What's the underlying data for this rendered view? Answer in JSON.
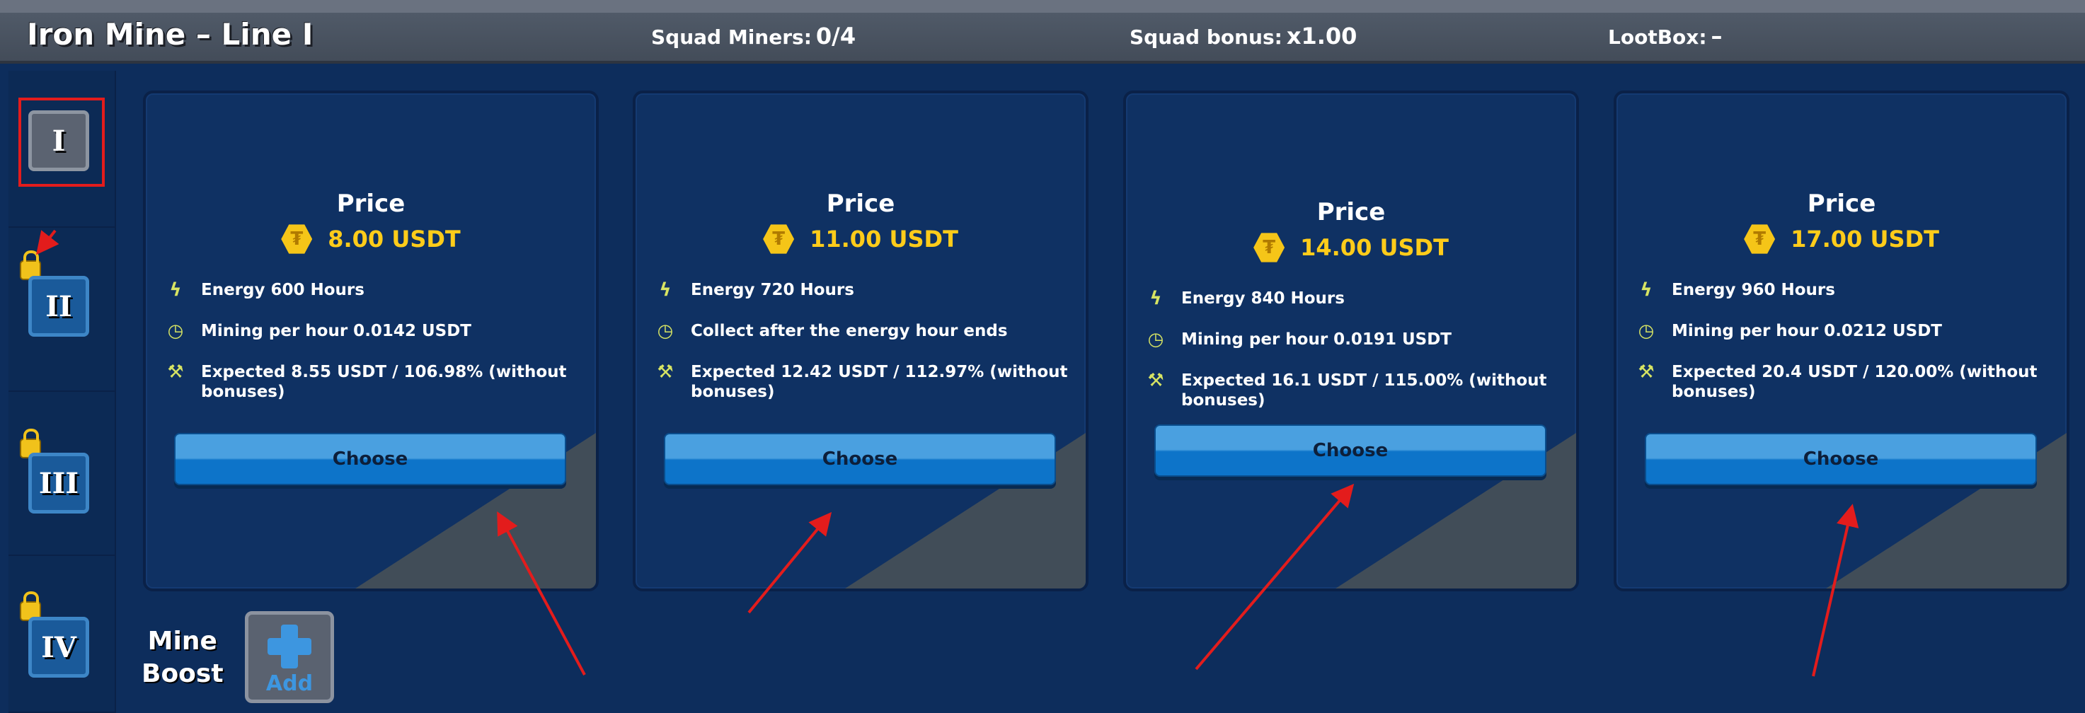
{
  "header": {
    "title": "Iron Mine – Line I",
    "squad_miners_label": "Squad Miners:",
    "squad_miners_value": "0/4",
    "squad_bonus_label": "Squad bonus:",
    "squad_bonus_value": "x1.00",
    "lootbox_label": "LootBox:",
    "lootbox_value": "–"
  },
  "sidebar": {
    "tiers": [
      {
        "label": "I",
        "locked": false,
        "selected": true
      },
      {
        "label": "II",
        "locked": true
      },
      {
        "label": "III",
        "locked": true
      },
      {
        "label": "IV",
        "locked": true
      }
    ]
  },
  "cards": [
    {
      "price_label": "Price",
      "price": "8.00 USDT",
      "features": [
        "Energy 600 Hours",
        "Mining per hour 0.0142 USDT",
        "Expected 8.55 USDT / 106.98% (without bonuses)"
      ],
      "button": "Choose"
    },
    {
      "price_label": "Price",
      "price": "11.00 USDT",
      "features": [
        "Energy 720 Hours",
        "Collect after the energy hour ends",
        "Expected 12.42 USDT / 112.97% (without bonuses)"
      ],
      "button": "Choose"
    },
    {
      "price_label": "Price",
      "price": "14.00 USDT",
      "features": [
        "Energy 840 Hours",
        "Mining per hour 0.0191 USDT",
        "Expected 16.1 USDT / 115.00% (without bonuses)"
      ],
      "button": "Choose"
    },
    {
      "price_label": "Price",
      "price": "17.00 USDT",
      "features": [
        "Energy 960 Hours",
        "Mining per hour 0.0212 USDT",
        "Expected 20.4 USDT / 120.00% (without bonuses)"
      ],
      "button": "Choose"
    }
  ],
  "icons": [
    "lightning-icon",
    "clock-icon",
    "shovel-icon",
    "usdt-coin-icon",
    "lock-icon",
    "plus-icon"
  ],
  "boost": {
    "label_line1": "Mine",
    "label_line2": "Boost",
    "add_label": "Add"
  },
  "colors": {
    "background": "#0d2d5c",
    "accent_yellow": "#ffcc1a",
    "button_blue": "#0d74c9",
    "annotation_red": "#e31c1c"
  }
}
